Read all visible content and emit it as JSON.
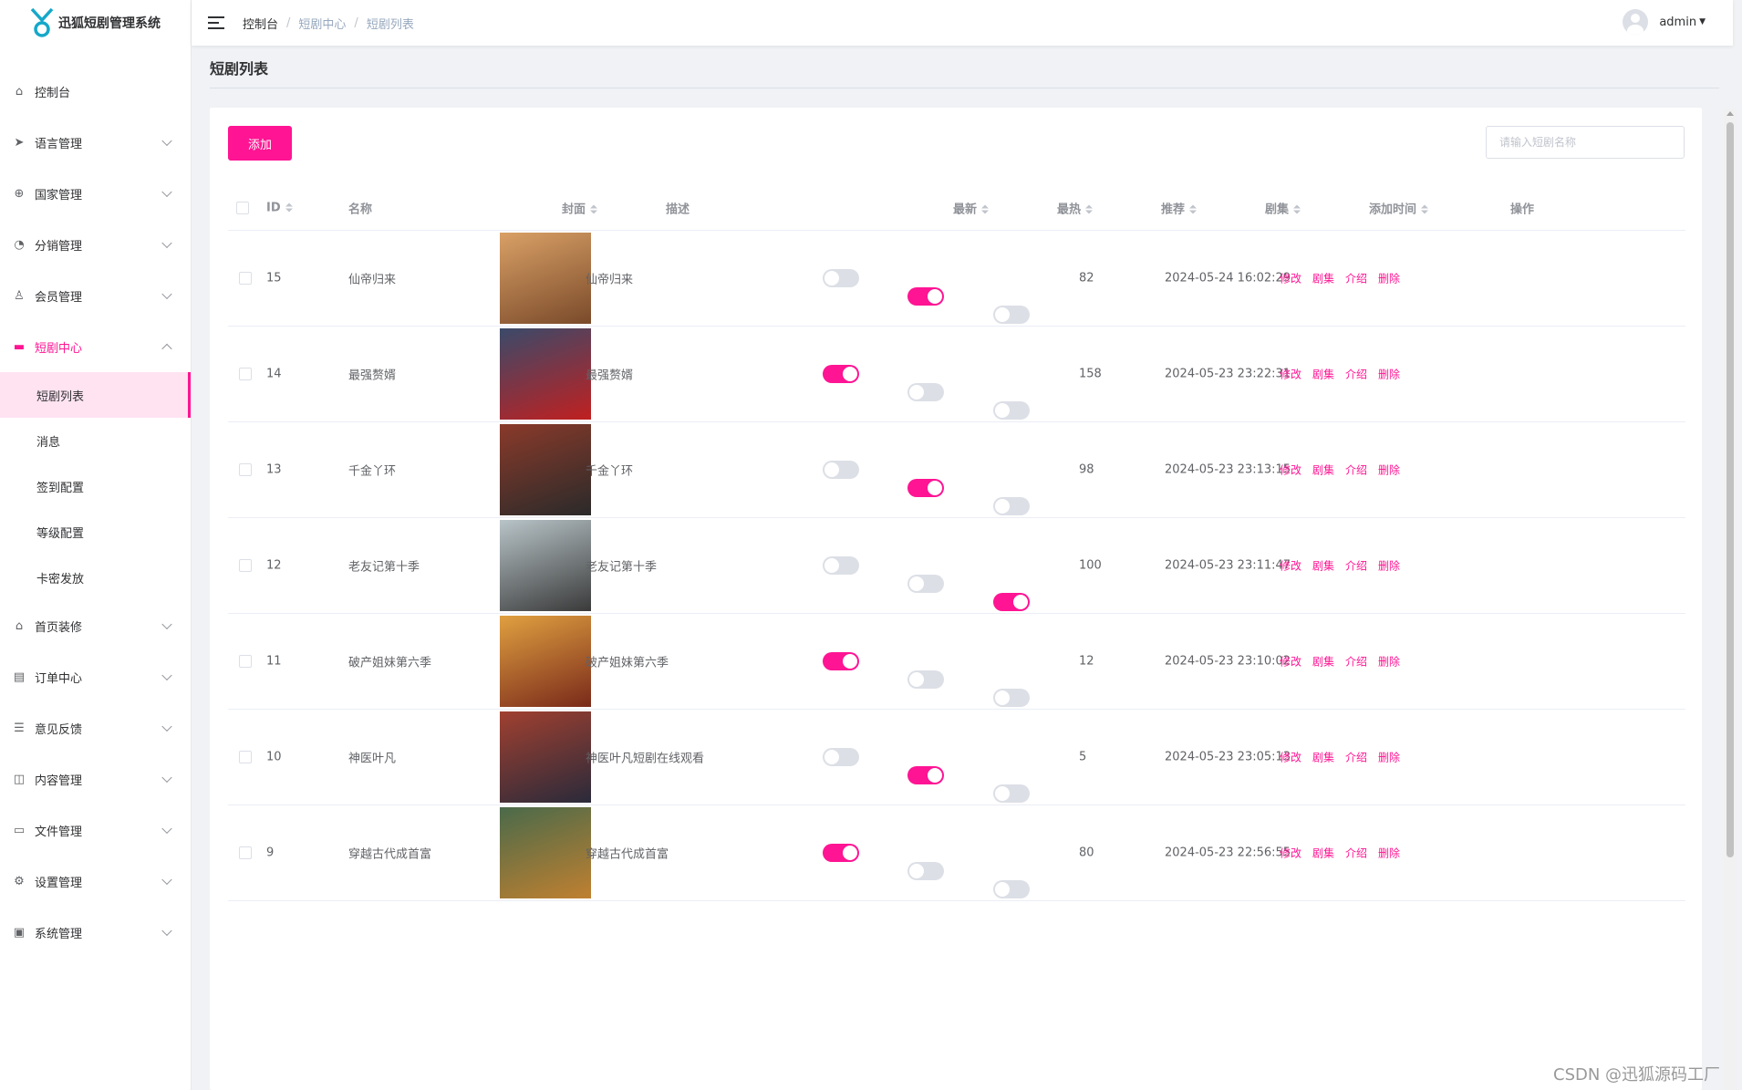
{
  "app": {
    "title": "迅狐短剧管理系统"
  },
  "header": {
    "breadcrumb": [
      "控制台",
      "短剧中心",
      "短剧列表"
    ],
    "user": "admin"
  },
  "sidebar": {
    "items": [
      {
        "label": "控制台",
        "icon": "home-icon"
      },
      {
        "label": "语言管理",
        "icon": "send-icon"
      },
      {
        "label": "国家管理",
        "icon": "globe-icon"
      },
      {
        "label": "分销管理",
        "icon": "pie-chart-icon"
      },
      {
        "label": "会员管理",
        "icon": "user-icon"
      },
      {
        "label": "短剧中心",
        "icon": "monitor-icon"
      },
      {
        "label": "首页装修",
        "icon": "home-icon"
      },
      {
        "label": "订单中心",
        "icon": "clipboard-icon"
      },
      {
        "label": "意见反馈",
        "icon": "document-icon"
      },
      {
        "label": "内容管理",
        "icon": "book-icon"
      },
      {
        "label": "文件管理",
        "icon": "briefcase-icon"
      },
      {
        "label": "设置管理",
        "icon": "gear-icon"
      },
      {
        "label": "系统管理",
        "icon": "settings-panel-icon"
      }
    ],
    "sub_items": [
      "短剧列表",
      "消息",
      "签到配置",
      "等级配置",
      "卡密发放"
    ]
  },
  "page": {
    "title": "短剧列表",
    "add_label": "添加",
    "search_placeholder": "请输入短剧名称"
  },
  "table": {
    "headers": [
      "ID",
      "名称",
      "封面",
      "描述",
      "最新",
      "最热",
      "推荐",
      "剧集",
      "添加时间",
      "操作"
    ],
    "actions": [
      "修改",
      "剧集",
      "介绍",
      "删除"
    ],
    "rows": [
      {
        "id": "15",
        "name": "仙帝归来",
        "desc": "仙帝归来",
        "newest": false,
        "hottest": true,
        "recommend": false,
        "episodes": "82",
        "time": "2024-05-24 16:02:29"
      },
      {
        "id": "14",
        "name": "最强赘婿",
        "desc": "最强赘婿",
        "newest": true,
        "hottest": false,
        "recommend": false,
        "episodes": "158",
        "time": "2024-05-23 23:22:31"
      },
      {
        "id": "13",
        "name": "千金丫环",
        "desc": "千金丫环",
        "newest": false,
        "hottest": true,
        "recommend": false,
        "episodes": "98",
        "time": "2024-05-23 23:13:15"
      },
      {
        "id": "12",
        "name": "老友记第十季",
        "desc": "老友记第十季",
        "newest": false,
        "hottest": false,
        "recommend": true,
        "episodes": "100",
        "time": "2024-05-23 23:11:47"
      },
      {
        "id": "11",
        "name": "破产姐妹第六季",
        "desc": "破产姐妹第六季",
        "newest": true,
        "hottest": false,
        "recommend": false,
        "episodes": "12",
        "time": "2024-05-23 23:10:02"
      },
      {
        "id": "10",
        "name": "神医叶凡",
        "desc": "神医叶凡短剧在线观看",
        "newest": false,
        "hottest": true,
        "recommend": false,
        "episodes": "5",
        "time": "2024-05-23 23:05:13"
      },
      {
        "id": "9",
        "name": "穿越古代成首富",
        "desc": "穿越古代成首富",
        "newest": true,
        "hottest": false,
        "recommend": false,
        "episodes": "80",
        "time": "2024-05-23 22:56:55"
      }
    ]
  },
  "watermark": "CSDN @迅狐源码工厂"
}
